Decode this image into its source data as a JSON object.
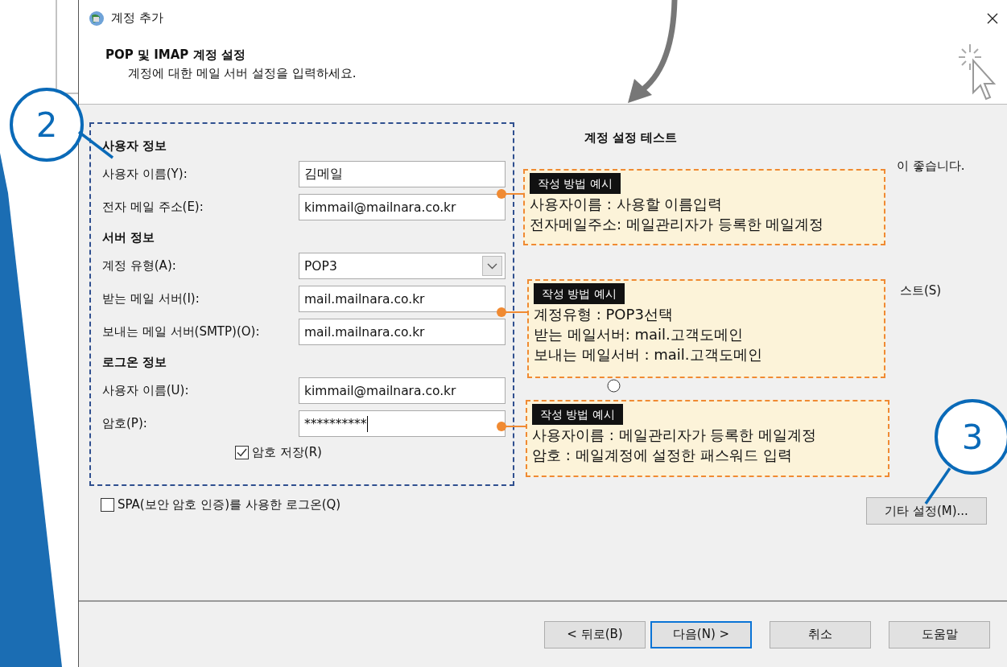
{
  "window": {
    "title": "계정 추가"
  },
  "header": {
    "title": "POP 및 IMAP 계정 설정",
    "subtitle": "계정에 대한 메일 서버 설정을 입력하세요."
  },
  "sections": [
    {
      "heading": "사용자 정보",
      "fields": [
        {
          "kind": "text",
          "label": "사용자 이름(Y):",
          "value": "김메일"
        },
        {
          "kind": "text",
          "label": "전자 메일 주소(E):",
          "value": "kimmail@mailnara.co.kr"
        }
      ]
    },
    {
      "heading": "서버 정보",
      "fields": [
        {
          "kind": "dropdown",
          "label": "계정 유형(A):",
          "value": "POP3"
        },
        {
          "kind": "text",
          "label": "받는 메일 서버(I):",
          "value": "mail.mailnara.co.kr"
        },
        {
          "kind": "text",
          "label": "보내는 메일 서버(SMTP)(O):",
          "value": "mail.mailnara.co.kr"
        }
      ]
    },
    {
      "heading": "로그온 정보",
      "fields": [
        {
          "kind": "text",
          "label": "사용자 이름(U):",
          "value": "kimmail@mailnara.co.kr"
        },
        {
          "kind": "password",
          "label": "암호(P):",
          "value": "**********"
        }
      ]
    }
  ],
  "remember_password": {
    "label": "암호 저장(R)",
    "checked": true
  },
  "spa_login": {
    "label": "SPA(보안 암호 인증)를 사용한 로그온(Q)",
    "checked": false
  },
  "test_panel": {
    "heading": "계정 설정 테스트",
    "fragment_1": "이 좋습니다.",
    "fragment_2": "스트(S)",
    "radio_selected": false
  },
  "more_settings_button": "기타 설정(M)...",
  "buttons": [
    {
      "label": "< 뒤로(B)",
      "default": false
    },
    {
      "label": "다음(N) >",
      "default": true
    },
    {
      "label": "취소",
      "default": false
    },
    {
      "label": "도움말",
      "default": false
    }
  ],
  "callouts": [
    {
      "tag": "작성 방법 예시",
      "lines": [
        "사용자이름 : 사용할 이름입력",
        "전자메일주소: 메일관리자가 등록한 메일계정"
      ]
    },
    {
      "tag": "작성 방법 예시",
      "lines": [
        "계정유형 : POP3선택",
        "받는 메일서버: mail.고객도메인",
        "보내는 메일서버 : mail.고객도메인"
      ]
    },
    {
      "tag": "작성 방법 예시",
      "lines": [
        "사용자이름 : 메일관리자가 등록한 메일계정",
        "암호 : 메일계정에 설정한 패스워드 입력"
      ]
    }
  ],
  "step_badges": [
    "2",
    "3"
  ]
}
